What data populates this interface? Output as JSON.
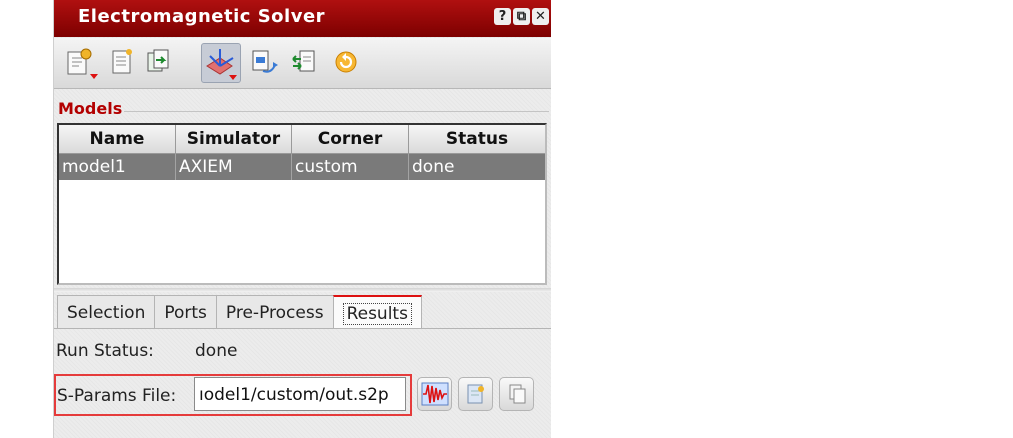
{
  "window": {
    "title": "Electromagnetic Solver",
    "buttons": [
      "?",
      "⧉",
      "✕"
    ]
  },
  "toolbar": {
    "icons": [
      "new-model-icon",
      "document-icon",
      "copy-model-icon",
      "simulate-icon",
      "export-icon",
      "sync-icon",
      "refresh-icon"
    ]
  },
  "models": {
    "label": "Models",
    "columns": [
      "Name",
      "Simulator",
      "Corner",
      "Status"
    ],
    "rows": [
      {
        "name": "model1",
        "simulator": "AXIEM",
        "corner": "custom",
        "status": "done"
      }
    ]
  },
  "tabs": [
    "Selection",
    "Ports",
    "Pre-Process",
    "Results"
  ],
  "active_tab": "Results",
  "results": {
    "run_status_label": "Run Status:",
    "run_status_value": "done",
    "sparams_label": "S-Params File:",
    "sparams_value": "ıodel1/custom/out.s2p"
  },
  "colors": {
    "title_bar": "#9b0000",
    "accent_red": "#e53b3b",
    "selection_row": "#7a7a7a"
  }
}
